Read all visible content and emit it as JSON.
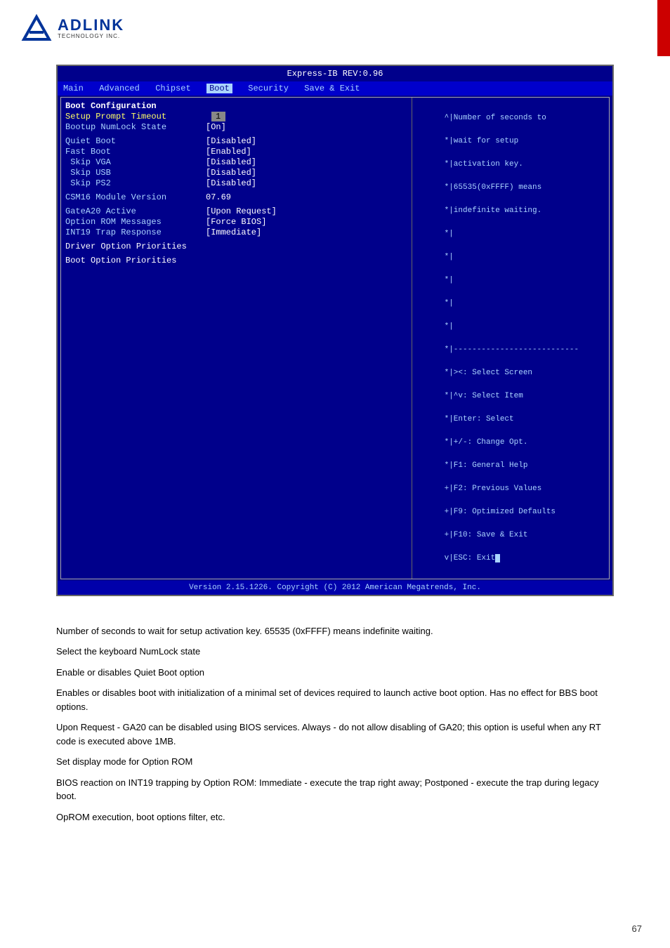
{
  "logo": {
    "company": "ADLINK",
    "subtitle": "TECHNOLOGY INC.",
    "reg": "®"
  },
  "bios": {
    "title": "Express-IB REV:0.96",
    "nav": {
      "items": [
        "Main",
        "Advanced",
        "Chipset",
        "Boot",
        "Security",
        "Save & Exit"
      ],
      "active": "Boot"
    },
    "separator_top": "/-------------------------------------------------------------------\\",
    "separator_bottom": "\\-------------------------------------------------------------------/",
    "left_rows": [
      {
        "label": "Boot Configuration",
        "value": ""
      },
      {
        "label": "Setup Prompt Timeout",
        "value": "1",
        "input": true
      },
      {
        "label": "Bootup NumLock State",
        "value": "[On]"
      },
      {
        "label": "",
        "value": ""
      },
      {
        "label": "Quiet Boot",
        "value": "[Disabled]"
      },
      {
        "label": "Fast Boot",
        "value": "[Enabled]"
      },
      {
        "label": " Skip VGA",
        "value": "[Disabled]"
      },
      {
        "label": " Skip USB",
        "value": "[Disabled]"
      },
      {
        "label": " Skip PS2",
        "value": "[Disabled]"
      },
      {
        "label": "",
        "value": ""
      },
      {
        "label": "CSM16 Module Version",
        "value": "07.69"
      },
      {
        "label": "",
        "value": ""
      },
      {
        "label": "GateA20 Active",
        "value": "[Upon Request]"
      },
      {
        "label": "Option ROM Messages",
        "value": "[Force BIOS]"
      },
      {
        "label": "INT19 Trap Response",
        "value": "[Immediate]"
      },
      {
        "label": "",
        "value": ""
      },
      {
        "label": "Driver Option Priorities",
        "value": ""
      },
      {
        "label": "",
        "value": ""
      },
      {
        "label": "Boot Option Priorities",
        "value": ""
      }
    ],
    "right_lines": [
      "^|Number of seconds to",
      "*|wait for setup",
      "*|activation key.",
      "*|65535(0xFFFF) means",
      "*|indefinite waiting.",
      "*|",
      "*|",
      "*|",
      "*|",
      "*|",
      "*|---------------------------",
      "*|><: Select Screen",
      "*|^v: Select Item",
      "*|Enter: Select",
      "*|+/-: Change Opt.",
      "*|F1: General Help",
      "+|F2: Previous Values",
      "+|F9: Optimized Defaults",
      "+|F10: Save & Exit",
      "v|ESC: Exit"
    ],
    "footer": "Version 2.15.1226. Copyright (C) 2012 American Megatrends, Inc."
  },
  "descriptions": [
    {
      "id": "desc-setup-prompt",
      "text": "Number of seconds to wait for setup activation key. 65535 (0xFFFF) means indefinite waiting."
    },
    {
      "id": "desc-numlock",
      "text": "Select the keyboard NumLock state"
    },
    {
      "id": "desc-quiet-boot",
      "text": "Enable or disables Quiet Boot option"
    },
    {
      "id": "desc-fast-boot",
      "text": "Enables or disables boot with initialization of a minimal set of devices required to launch active boot option. Has no effect for BBS boot options."
    },
    {
      "id": "desc-gatea20",
      "text": "Upon Request - GA20 can be disabled using BIOS services. Always - do not allow disabling of GA20; this option is useful when any RT code is executed above 1MB."
    },
    {
      "id": "desc-option-rom",
      "text": "Set display mode for Option ROM"
    },
    {
      "id": "desc-int19",
      "text": "BIOS reaction on INT19 trapping by Option ROM: Immediate - execute the trap right away; Postponed - execute the trap during legacy boot."
    },
    {
      "id": "desc-driver-opts",
      "text": "OpROM execution, boot options filter, etc."
    }
  ],
  "page_number": "67"
}
